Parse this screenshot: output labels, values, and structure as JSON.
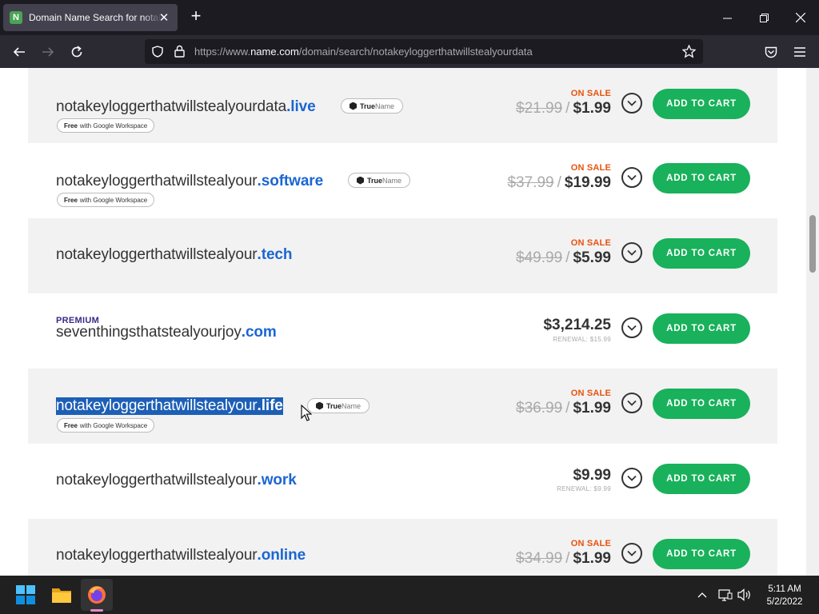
{
  "browser": {
    "tab_title": "Domain Name Search for notakeyloggerthatwillstealyourdata",
    "favicon_letter": "N",
    "url_prefix": "https://www.",
    "url_host": "name.com",
    "url_path": "/domain/search/notakeyloggerthatwillstealyourdata"
  },
  "results": [
    {
      "name": "notakeyloggerthatwillstealyourdata",
      "tld": ".live",
      "truename": true,
      "workspace": true,
      "on_sale": "ON SALE",
      "old_price": "$21.99",
      "price": "$1.99",
      "button": "ADD TO CART"
    },
    {
      "name": "notakeyloggerthatwillstealyour",
      "tld": ".software",
      "truename": true,
      "workspace": true,
      "on_sale": "ON SALE",
      "old_price": "$37.99",
      "price": "$19.99",
      "button": "ADD TO CART"
    },
    {
      "name": "notakeyloggerthatwillstealyour",
      "tld": ".tech",
      "on_sale": "ON SALE",
      "old_price": "$49.99",
      "price": "$5.99",
      "button": "ADD TO CART"
    },
    {
      "premium": "PREMIUM",
      "name": "seventhingsthatstealyourjoy",
      "tld": ".com",
      "price": "$3,214.25",
      "renewal": "RENEWAL: $15.99",
      "button": "ADD TO CART"
    },
    {
      "name": "notakeyloggerthatwillstealyour",
      "tld": ".life",
      "selected": true,
      "truename": true,
      "workspace": true,
      "on_sale": "ON SALE",
      "old_price": "$36.99",
      "price": "$1.99",
      "button": "ADD TO CART"
    },
    {
      "name": "notakeyloggerthatwillstealyour",
      "tld": ".work",
      "price": "$9.99",
      "renewal": "RENEWAL: $9.99",
      "button": "ADD TO CART"
    },
    {
      "name": "notakeyloggerthatwillstealyour",
      "tld": ".online",
      "on_sale": "ON SALE",
      "old_price": "$34.99",
      "price": "$1.99",
      "button": "ADD TO CART"
    }
  ],
  "badges": {
    "truename_strong": "True",
    "truename_rest": "Name",
    "workspace_free": "Free",
    "workspace_rest": "with Google Workspace"
  },
  "taskbar": {
    "time": "5:11 AM",
    "date": "5/2/2022"
  },
  "colors": {
    "cart_green": "#19b15b",
    "tld_blue": "#1b66d2",
    "sale_orange": "#e8520e",
    "selection_blue": "#1d5fb6"
  }
}
